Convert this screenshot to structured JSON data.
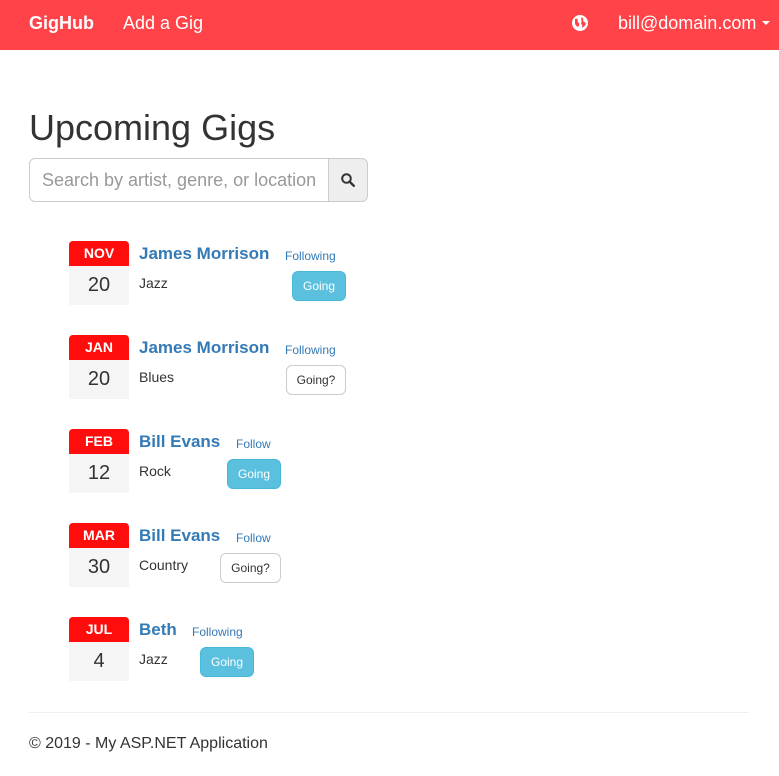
{
  "nav": {
    "brand": "GigHub",
    "add_gig": "Add a Gig",
    "globe_icon": "globe-icon",
    "user": "bill@domain.com"
  },
  "page_title": "Upcoming Gigs",
  "search": {
    "placeholder": "Search by artist, genre, or location...",
    "value": "",
    "icon": "search-icon"
  },
  "gigs": [
    {
      "month": "NOV",
      "day": "20",
      "artist": "James Morrison",
      "follow": "Following",
      "genre": "Jazz",
      "attend": "Going",
      "attending": true
    },
    {
      "month": "JAN",
      "day": "20",
      "artist": "James Morrison",
      "follow": "Following",
      "genre": "Blues",
      "attend": "Going?",
      "attending": false
    },
    {
      "month": "FEB",
      "day": "12",
      "artist": "Bill Evans",
      "follow": "Follow",
      "genre": "Rock",
      "attend": "Going",
      "attending": true
    },
    {
      "month": "MAR",
      "day": "30",
      "artist": "Bill Evans",
      "follow": "Follow",
      "genre": "Country",
      "attend": "Going?",
      "attending": false
    },
    {
      "month": "JUL",
      "day": "4",
      "artist": "Beth",
      "follow": "Following",
      "genre": "Jazz",
      "attend": "Going",
      "attending": true
    }
  ],
  "footer": "© 2019 - My ASP.NET Application",
  "colors": {
    "navbar": "#ff4349",
    "calendar_month": "#ff0d0d",
    "link": "#337ab7",
    "going": "#5bc0de"
  }
}
